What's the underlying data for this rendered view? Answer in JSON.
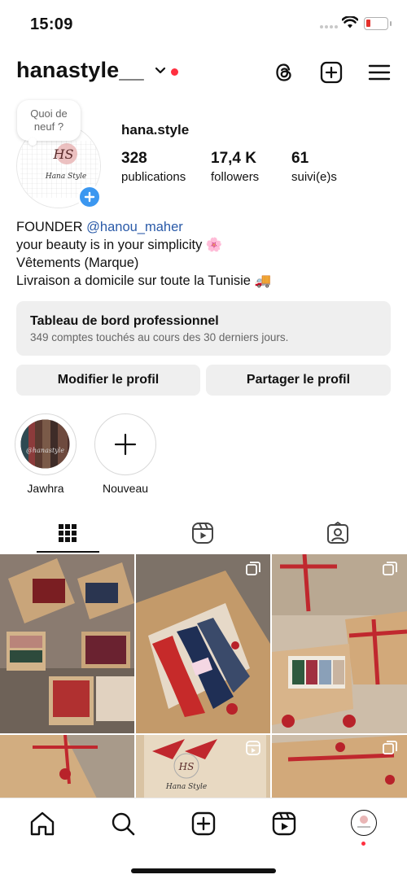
{
  "status_bar": {
    "time": "15:09"
  },
  "header": {
    "username": "hanastyle__"
  },
  "profile": {
    "display_name": "hana.style",
    "note": "Quoi de neuf ?",
    "logo_text": "Hana Style",
    "logo_initials": "HS",
    "stats": [
      {
        "value": "328",
        "label": "publications"
      },
      {
        "value": "17,4 K",
        "label": "followers"
      },
      {
        "value": "61",
        "label": "suivi(e)s"
      }
    ],
    "bio": {
      "line1_prefix": "FOUNDER ",
      "line1_mention": "@hanou_maher",
      "line2": "your beauty is in your simplicity 🌸",
      "line3": "Vêtements (Marque)",
      "line4": "Livraison a domicile sur toute la Tunisie 🚚"
    }
  },
  "dashboard": {
    "title": "Tableau de bord professionnel",
    "subtitle": "349 comptes touchés au cours des 30 derniers jours."
  },
  "actions": {
    "edit_profile": "Modifier le profil",
    "share_profile": "Partager le profil"
  },
  "highlights": [
    {
      "label": "Jawhra",
      "overlay": "@hanastyle"
    },
    {
      "label": "Nouveau"
    }
  ],
  "tabs": [
    {
      "icon": "grid-icon",
      "active": true
    },
    {
      "icon": "reels-icon",
      "active": false
    },
    {
      "icon": "tagged-icon",
      "active": false
    }
  ],
  "bottom_nav": [
    "home-icon",
    "search-icon",
    "create-icon",
    "reels-icon",
    "profile-avatar"
  ],
  "colors": {
    "accent_blue": "#3b97f0",
    "mention": "#2a5aa8",
    "notification": "#ff3040",
    "button_bg": "#efefef"
  }
}
